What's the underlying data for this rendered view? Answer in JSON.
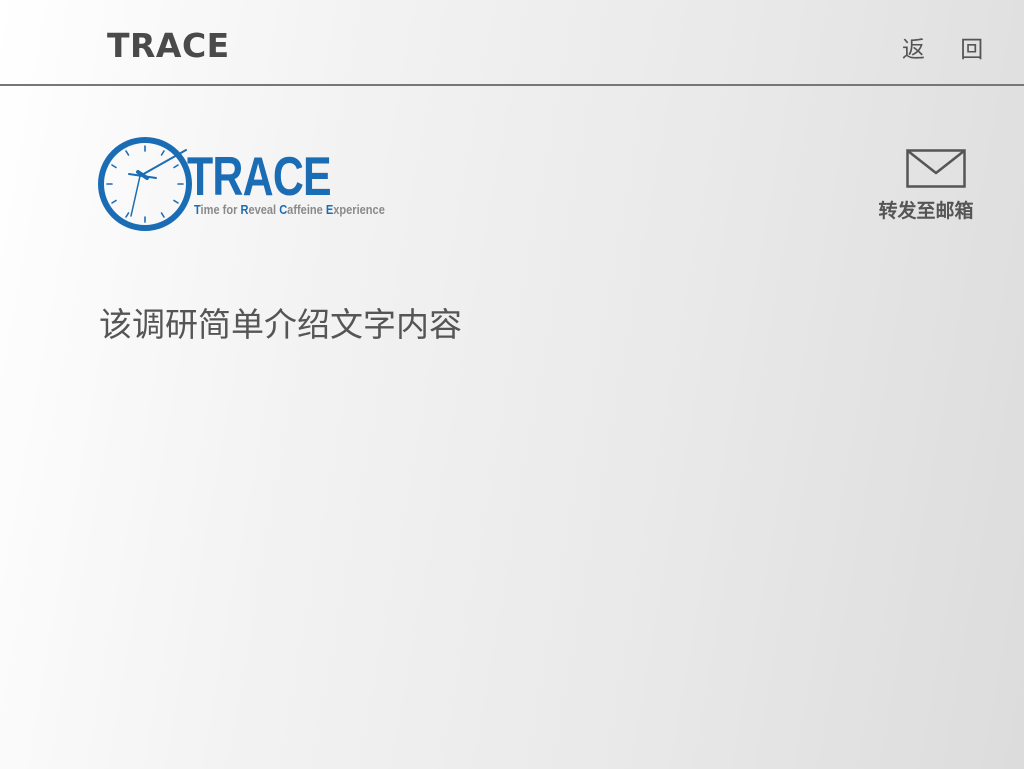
{
  "header": {
    "title": "TRACE",
    "back_label": "返 回"
  },
  "logo": {
    "wordmark": "TRACE",
    "tagline": [
      {
        "cap": "T",
        "rest": "ime for "
      },
      {
        "cap": "R",
        "rest": "eveal "
      },
      {
        "cap": "C",
        "rest": "affeine "
      },
      {
        "cap": "E",
        "rest": "xperience"
      }
    ],
    "accent_color": "#1a6db5"
  },
  "share": {
    "icon": "mail-icon",
    "label": "转发至邮箱"
  },
  "content": {
    "intro": "该调研简单介绍文字内容"
  }
}
